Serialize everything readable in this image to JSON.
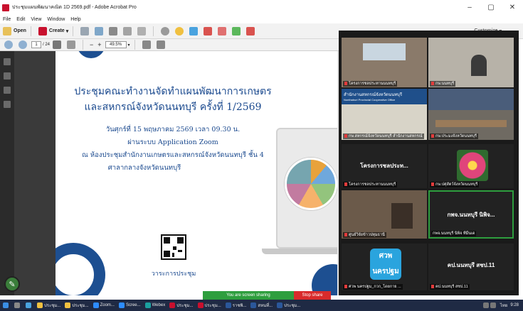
{
  "window": {
    "title": "ประชุมแผนพัฒนาคณิต 1D 2569.pdf - Adobe Acrobat Pro",
    "minimize": "–",
    "maximize": "▢",
    "close": "✕"
  },
  "menu": [
    "File",
    "Edit",
    "View",
    "Window",
    "Help"
  ],
  "toolbar": {
    "open_label": "Open",
    "create_label": "Create",
    "create_arrow": "▾",
    "customize_label": "Customize",
    "customize_arrow": "▾"
  },
  "nav": {
    "page_current": "1",
    "page_total": "/ 24",
    "zoom_value": "49.5%",
    "zoom_minus": "−",
    "zoom_plus": "+"
  },
  "document": {
    "title_line1": "ประชุมคณะทำงานจัดทำแผนพัฒนาการเกษตร",
    "title_line2": "และสหกรณ์จังหวัดนนทบุรี ครั้งที่ 1/2569",
    "date_line": "วันศุกร์ที่ 15 พฤษภาคม 2569  เวลา 09.30 น.",
    "via_line": "ผ่านระบบ Application Zoom",
    "place_line": "ณ ห้องประชุมสำนักงานเกษตรและสหกรณ์จังหวัดนนทบุรี ชั้น 4",
    "hall_line": "ศาลากลางจังหวัดนนทบุรี",
    "qr_label": "วาระการประชุม"
  },
  "zoom": {
    "tiles": [
      {
        "label": "โครงการชลประทานนนทบุรี"
      },
      {
        "label": "กษ.นนทบุรี"
      },
      {
        "label": "กษ.สหกรณ์จังหวัดนนทบุรี สำนักงานสหกรณ์"
      },
      {
        "label": "กษ.ประมงจังหวัดนนทบุรี"
      },
      {
        "label": "โครงการชลประทานนนทบุรี",
        "center": "โครงการชลประท..."
      },
      {
        "label": "กษ.ปศุสัตว์จังหวัดนนทบุรี"
      },
      {
        "label": "ศูนย์วิจัยข้าวปทุมธานี"
      },
      {
        "label": "กพจ.นนทบุรี นิพิจ ทีมิ้นเด",
        "center": "กพจ.นนทบุรี นิพิจ..."
      },
      {
        "label": "ศวพ นครปฐม_กวก_โดยกาย ...",
        "logo_text": "ศวพ นครปฐม"
      },
      {
        "label": "คป.นนทบุรี สชป.11",
        "center": "คป.นนทบุรี สชป.11"
      }
    ],
    "banner_text": "สำนักงานสหกรณ์จังหวัดนนทบุรี",
    "banner_sub": "Nonthaburi Provincial Cooperative Office"
  },
  "share": {
    "status": "You are screen sharing",
    "stop": "Stop share"
  },
  "taskbar": {
    "items": [
      "ประชุม...",
      "ประชุม...",
      "Zoom...",
      "Scree...",
      "Webex",
      "ประชุม...",
      "ประชุม...",
      "ราชพิ...",
      "สหนที่...",
      "ประชุม..."
    ],
    "lang": "ไทย",
    "time": "9:28"
  },
  "colors": {
    "doc_blue": "#1b4a8f",
    "share_green": "#2e9e3e",
    "share_red": "#d92b2b"
  }
}
